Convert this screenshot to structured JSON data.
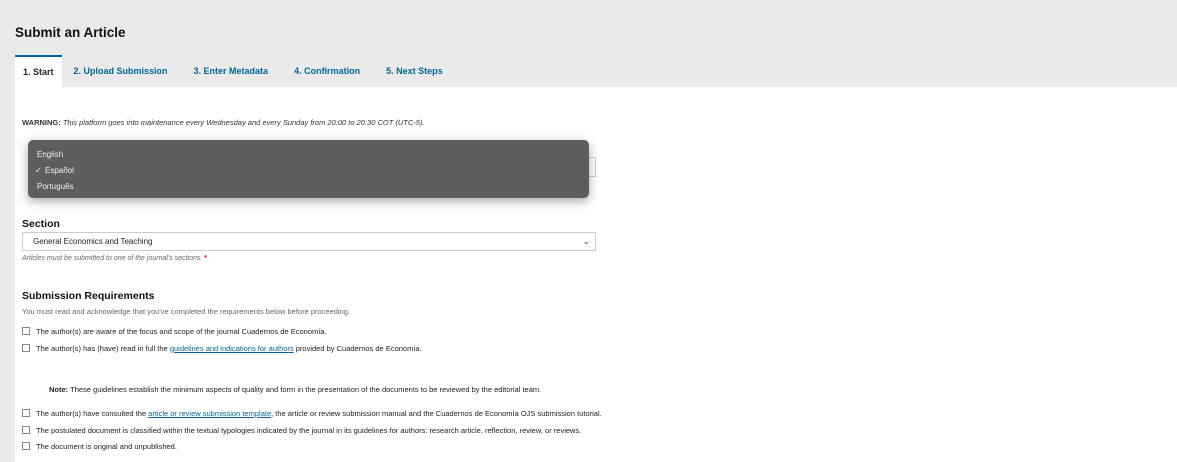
{
  "page": {
    "title": "Submit an Article"
  },
  "tabs": [
    {
      "label": "1. Start",
      "active": true
    },
    {
      "label": "2. Upload Submission",
      "active": false
    },
    {
      "label": "3. Enter Metadata",
      "active": false
    },
    {
      "label": "4. Confirmation",
      "active": false
    },
    {
      "label": "5. Next Steps",
      "active": false
    }
  ],
  "warning": {
    "prefix": "WARNING:",
    "text": "This platform goes into maintenance every Wednesday and every Sunday from 20:00 to 20:30 COT (UTC-5)."
  },
  "language_dropdown": {
    "options": [
      "English",
      "Español",
      "Português"
    ],
    "selected": "Español",
    "check_glyph": "✓"
  },
  "section": {
    "label": "Section",
    "selected": "General Economics and Teaching",
    "help": "Articles must be submitted to one of the journal's sections.",
    "required_mark": "*"
  },
  "requirements": {
    "label": "Submission Requirements",
    "subtext": "You must read and acknowledge that you've completed the requirements below before proceeding.",
    "items": [
      {
        "text": "The author(s) are aware of the focus and scope of the journal Cuadernos de Economía."
      },
      {
        "before": "The author(s) has (have) read in full the ",
        "link": "guidelines and indications for authors",
        "after": " provided by Cuadernos de Economía."
      }
    ],
    "note_label": "Note:",
    "note_text": "These guidelines establish the minimum aspects of quality and form in the presentation of the documents to be reviewed by the editorial team.",
    "items_after_note": [
      {
        "before": "The author(s) have consulted the ",
        "link": "article or review submission template",
        "after": ", the article or review submission manual and the Cuadernos de Economía OJS submission tutorial."
      },
      {
        "text": "The postulated document is classified within the textual typologies indicated by the journal in its guidelines for authors: research article, reflection, review, or reviews."
      },
      {
        "text": "The document is original and unpublished."
      }
    ]
  },
  "icons": {
    "chevron": "⌄"
  }
}
